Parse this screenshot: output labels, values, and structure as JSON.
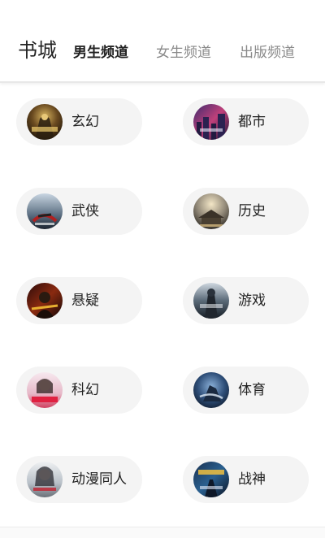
{
  "header": {
    "title": "书城",
    "tabs": [
      {
        "label": "男生频道",
        "active": true
      },
      {
        "label": "女生频道",
        "active": false
      },
      {
        "label": "出版频道",
        "active": false
      }
    ]
  },
  "categories": [
    {
      "label": "玄幻",
      "cover_icon": "fantasy-cover-icon"
    },
    {
      "label": "都市",
      "cover_icon": "urban-cover-icon"
    },
    {
      "label": "武侠",
      "cover_icon": "martial-arts-cover-icon"
    },
    {
      "label": "历史",
      "cover_icon": "history-cover-icon"
    },
    {
      "label": "悬疑",
      "cover_icon": "suspense-cover-icon"
    },
    {
      "label": "游戏",
      "cover_icon": "game-cover-icon"
    },
    {
      "label": "科幻",
      "cover_icon": "scifi-cover-icon"
    },
    {
      "label": "体育",
      "cover_icon": "sports-cover-icon"
    },
    {
      "label": "动漫同人",
      "cover_icon": "anime-cover-icon"
    },
    {
      "label": "战神",
      "cover_icon": "war-god-cover-icon"
    }
  ],
  "colors": {
    "active_tab": "#222222",
    "inactive_tab": "#8a8a8a",
    "pill_background": "#f4f4f4"
  }
}
